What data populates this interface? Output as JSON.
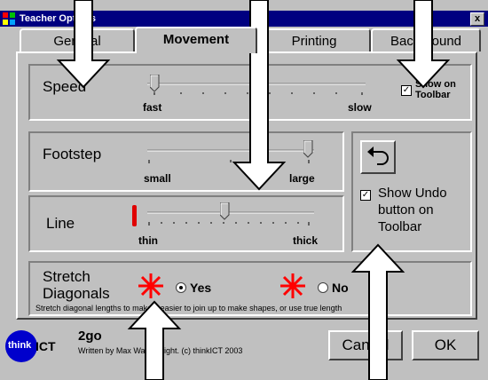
{
  "window": {
    "title": "Teacher Options",
    "close_label": "x"
  },
  "tabs": [
    {
      "label": "General",
      "active": false
    },
    {
      "label": "Movement",
      "active": true
    },
    {
      "label": "Printing",
      "active": false
    },
    {
      "label": "Background",
      "active": false
    }
  ],
  "speed": {
    "label": "Speed",
    "min_label": "fast",
    "max_label": "slow",
    "value": 0.0,
    "show_on_toolbar_label": "Show on Toolbar",
    "show_on_toolbar_checked": true
  },
  "footstep": {
    "label": "Footstep",
    "min_label": "small",
    "max_label": "large",
    "value": 1.0
  },
  "line": {
    "label": "Line",
    "min_label": "thin",
    "max_label": "thick",
    "value": 0.55,
    "line_color": "#e00000"
  },
  "undo": {
    "show_label": "Show Undo button on Toolbar",
    "checked": true
  },
  "stretch": {
    "title": "Stretch Diagonals",
    "yes_label": "Yes",
    "no_label": "No",
    "selected": "Yes",
    "help_text": "Stretch diagonal lengths to make it easier to join up to make shapes, or use true length"
  },
  "footer": {
    "logo_think": "think",
    "logo_ict": "ICT",
    "app_name": "2go",
    "credit": "Written by Max Wainewright. (c) thinkICT 2003",
    "cancel_label": "Cancel",
    "ok_label": "OK"
  },
  "colors": {
    "accent_red": "#ff0000",
    "title_bar": "#000080",
    "face": "#c0c0c0",
    "logo_blue": "#0000cc"
  }
}
